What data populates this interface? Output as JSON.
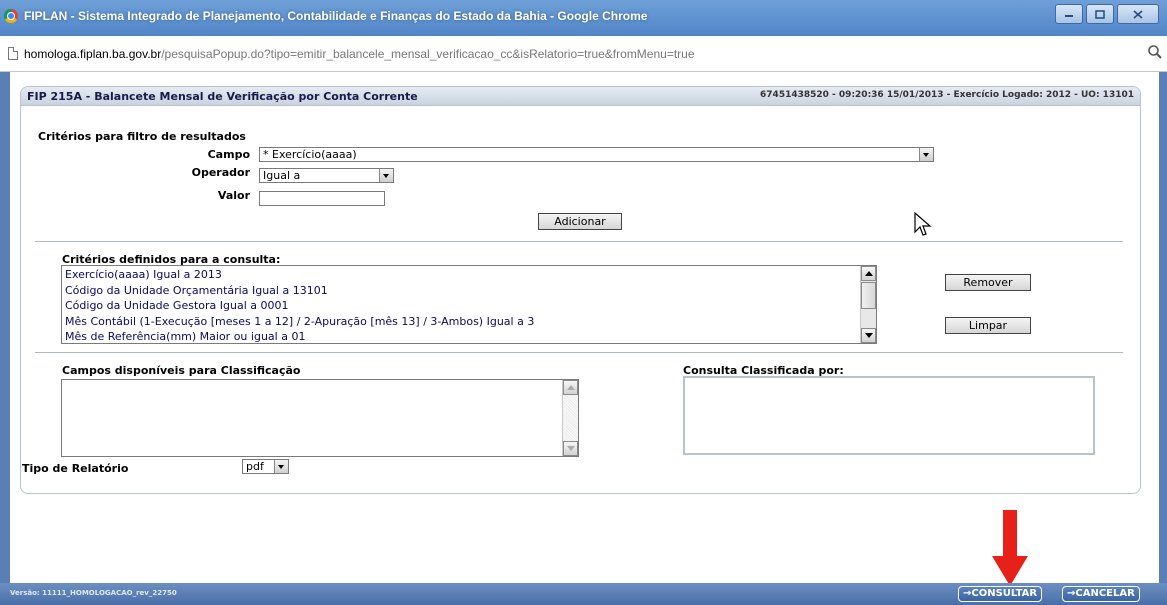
{
  "window": {
    "title": "FIPLAN - Sistema Integrado de Planejamento, Contabilidade e Finanças do Estado da Bahia - Google Chrome",
    "buttons": [
      "minimize",
      "maximize",
      "close"
    ]
  },
  "address": {
    "host": "homologa.fiplan.ba.gov.br",
    "path": "/pesquisaPopup.do?tipo=emitir_balancele_mensal_verificacao_cc&isRelatorio=true&fromMenu=true"
  },
  "header": {
    "title": "FIP 215A - Balancete Mensal de Verificação por Conta Corrente",
    "info": "67451438520 - 09:20:36 15/01/2013 - Exercício Logado: 2012 - UO: 13101"
  },
  "filter": {
    "section_title": "Critérios para filtro de resultados",
    "campo_label": "Campo",
    "campo_value": "* Exercício(aaaa)",
    "operador_label": "Operador",
    "operador_value": "Igual a",
    "valor_label": "Valor",
    "valor_value": "",
    "add_button": "Adicionar"
  },
  "criteria": {
    "section_title": "Critérios definidos para a consulta:",
    "items": [
      "Exercício(aaaa) Igual a 2013",
      "Código da Unidade Orçamentária Igual a 13101",
      "Código da Unidade Gestora Igual a 0001",
      "Mês Contábil (1-Execução [meses 1 a 12] / 2-Apuração [mês 13] / 3-Ambos) Igual a 3",
      "Mês de Referência(mm) Maior ou igual a 01"
    ],
    "remove_button": "Remover",
    "clear_button": "Limpar"
  },
  "classification": {
    "available_title": "Campos disponíveis para Classificação",
    "sorted_title": "Consulta Classificada por:"
  },
  "report": {
    "label": "Tipo de Relatório",
    "value": "pdf"
  },
  "footer": {
    "version": "Versão: 11111_HOMOLOGACAO_rev_22750",
    "consultar": "→CONSULTAR",
    "cancelar": "→CANCELAR"
  },
  "colors": {
    "accent_red": "#e8201a",
    "titlebar": "#5b8dcb",
    "statusbar": "#4a6fa8"
  }
}
